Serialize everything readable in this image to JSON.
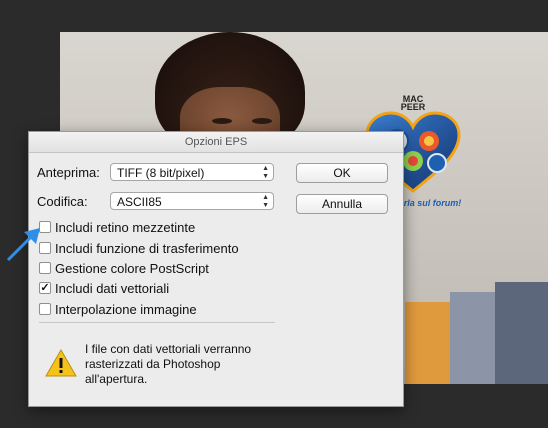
{
  "dialog": {
    "title": "Opzioni EPS",
    "preview_label": "Anteprima:",
    "preview_value": "TIFF  (8 bit/pixel)",
    "encoding_label": "Codifica:",
    "encoding_value": "ASCII85",
    "ok_label": "OK",
    "cancel_label": "Annulla",
    "options": [
      {
        "label": "Includi retino mezzetinte",
        "checked": false
      },
      {
        "label": "Includi funzione di trasferimento",
        "checked": false
      },
      {
        "label": "Gestione colore PostScript",
        "checked": false
      },
      {
        "label": "Includi dati vettoriali",
        "checked": true
      },
      {
        "label": "Interpolazione immagine",
        "checked": false
      }
    ],
    "warning_text": "I file con dati vettoriali verranno rasterizzati da Photoshop all'apertura."
  },
  "background": {
    "logo_text_line1": "MAC",
    "logo_text_line2": "PEER",
    "tagline": "Se ne parla sul forum!"
  },
  "colors": {
    "accent_arrow": "#2f8fe6",
    "warning_yellow": "#f4c21b"
  }
}
